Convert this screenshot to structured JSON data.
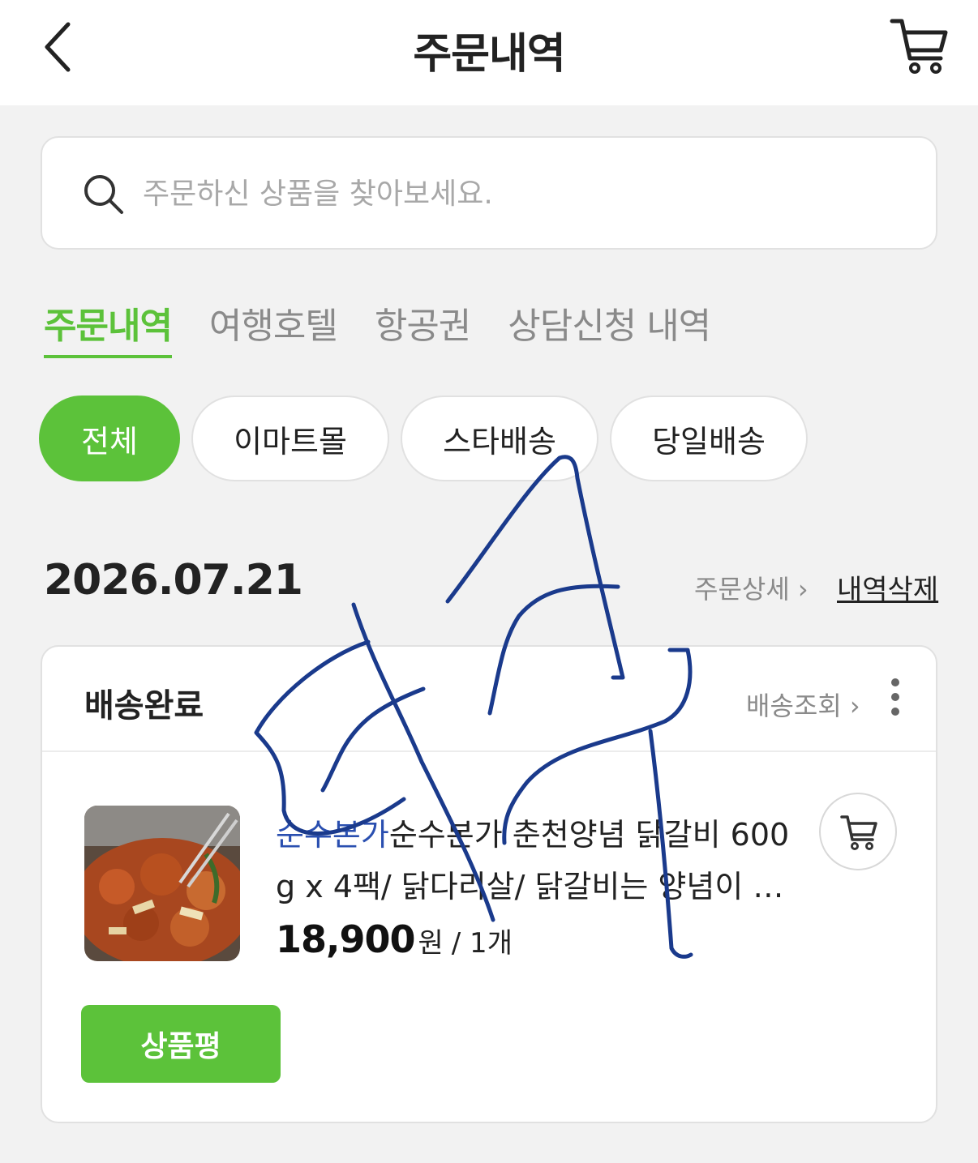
{
  "header": {
    "title": "주문내역",
    "back_icon": "chevron-left-icon",
    "cart_icon": "cart-icon"
  },
  "search": {
    "placeholder": "주문하신 상품을 찾아보세요.",
    "value": "",
    "icon": "search-icon"
  },
  "tabs": [
    {
      "label": "주문내역",
      "active": true
    },
    {
      "label": "여행호텔",
      "active": false
    },
    {
      "label": "항공권",
      "active": false
    },
    {
      "label": "상담신청 내역",
      "active": false
    }
  ],
  "filters": [
    {
      "label": "전체",
      "active": true
    },
    {
      "label": "이마트몰",
      "active": false
    },
    {
      "label": "스타배송",
      "active": false
    },
    {
      "label": "당일배송",
      "active": false
    }
  ],
  "order": {
    "date": "2026.07.21",
    "detail_link": "주문상세 ›",
    "delete_link": "내역삭제",
    "status": "배송완료",
    "tracking_link": "배송조회 ›",
    "item": {
      "brand": "순수본가",
      "name": "순수본가 춘천양념 닭갈비 600g x 4팩/ 닭다리살/ 닭갈비는 양념이 맛있어야",
      "price": "18,900",
      "price_unit": "원",
      "quantity": "/ 1개"
    },
    "review_button": "상품평"
  },
  "colors": {
    "accent": "#5cc23a",
    "brand_text": "#2a4fb0",
    "background": "#f2f2f2",
    "scribble": "#1a3a8c"
  }
}
